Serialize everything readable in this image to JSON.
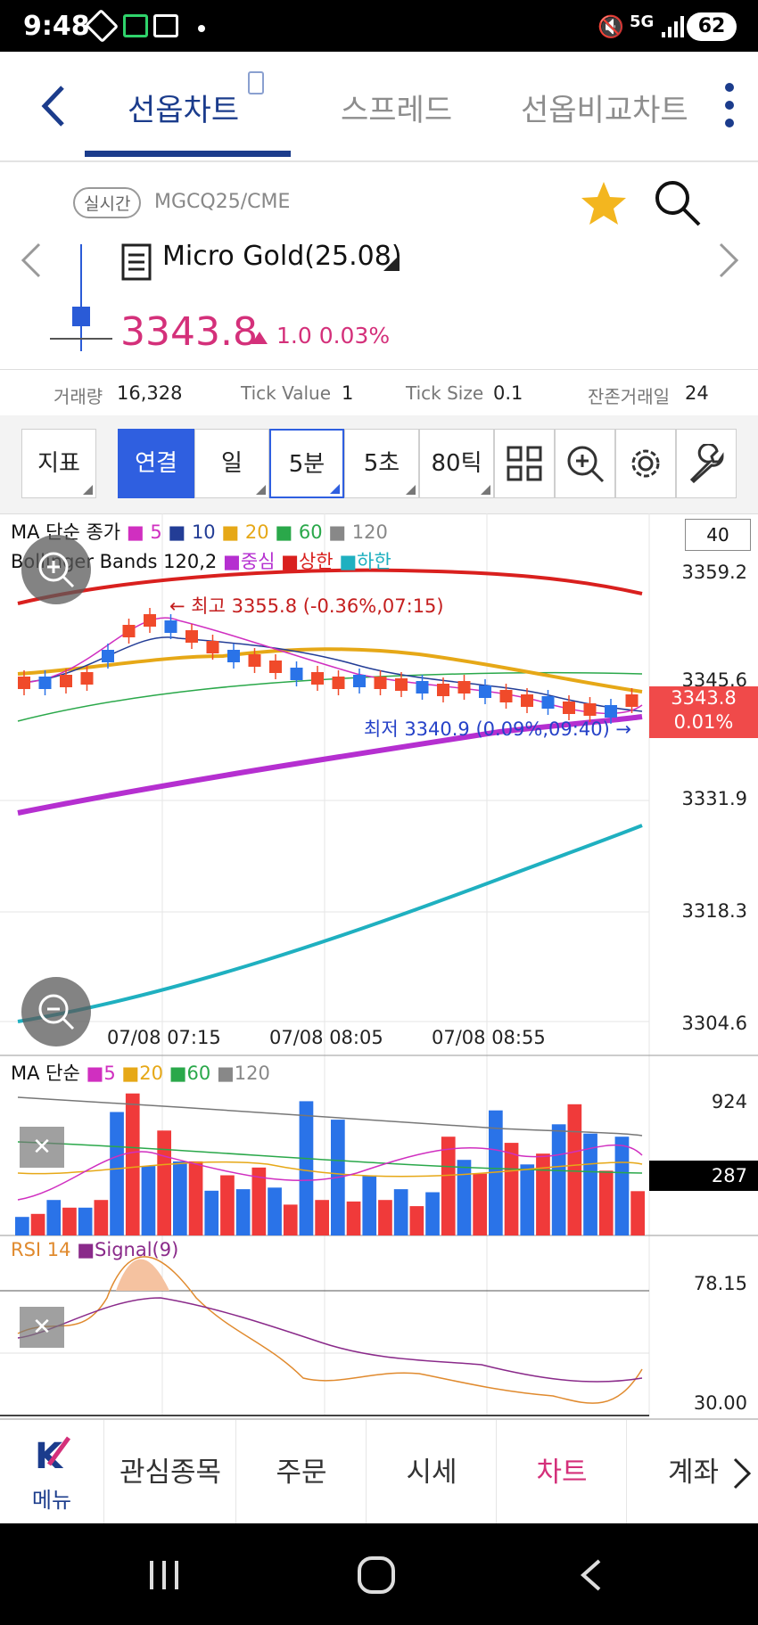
{
  "status_bar": {
    "time": "9:48",
    "battery": "62",
    "network": "5G"
  },
  "header": {
    "tabs": [
      {
        "label": "선옵차트"
      },
      {
        "label": "스프레드"
      },
      {
        "label": "선옵비교차트"
      }
    ]
  },
  "instrument": {
    "realtime_badge": "실시간",
    "code": "MGCQ25/CME",
    "name": "Micro Gold(25.08)",
    "price": "3343.8",
    "change": "1.0 0.03%",
    "colors": {
      "up": "#d4307a",
      "accent": "#1b3c8c",
      "star": "#f3b61f"
    }
  },
  "info": {
    "volume_label": "거래량",
    "volume_value": "16,328",
    "tick_value_label": "Tick Value",
    "tick_value_value": "1",
    "tick_size_label": "Tick Size",
    "tick_size_value": "0.1",
    "remaining_label": "잔존거래일",
    "remaining_value": "24"
  },
  "toolbar": {
    "indicator": "지표",
    "linked": "연결",
    "day": "일",
    "min5": "5분",
    "sec5": "5초",
    "tick80": "80틱",
    "icons": [
      "grid-icon",
      "zoom-in-icon",
      "gear-icon",
      "wrench-icon"
    ]
  },
  "price_chart": {
    "ma_legend": {
      "title": "MA 단순 종가",
      "p1": "5",
      "p2": "10",
      "p3": "20",
      "p4": "60",
      "p5": "120"
    },
    "bb_legend": {
      "title": "Bollinger Bands 120,2",
      "mid": "중심",
      "upper": "상한",
      "lower": "하한"
    },
    "period_box": "40",
    "high_note": "← 최고 3355.8 (-0.36%,07:15)",
    "low_note": "최저 3340.9 (0.09%,09:40) →",
    "current_price": "3343.8",
    "current_pct": "0.01%",
    "y_labels": [
      "3359.2",
      "3345.6",
      "3331.9",
      "3318.3",
      "3304.6"
    ],
    "x_labels": [
      "07/08 07:15",
      "07/08 08:05",
      "07/08 08:55"
    ]
  },
  "volume_chart": {
    "legend": {
      "title": "MA 단순",
      "p1": "5",
      "p2": "20",
      "p3": "60",
      "p4": "120"
    },
    "y_labels": [
      "924"
    ],
    "current": "287"
  },
  "rsi_chart": {
    "legend": {
      "rsi": "RSI 14",
      "signal": "Signal(9)"
    },
    "y_labels": [
      "78.15",
      "30.00"
    ]
  },
  "chart_data": [
    {
      "type": "line",
      "title": "Micro Gold(25.08) 5분",
      "ylim": [
        3304.6,
        3359.2
      ],
      "x": [
        "07/08 07:15",
        "07/08 08:05",
        "07/08 08:55"
      ],
      "series": [
        {
          "name": "상한",
          "values": [
            3355.5,
            3357.5,
            3357.3,
            3355.6
          ]
        },
        {
          "name": "하한",
          "values": [
            3305.0,
            3310.5,
            3318.0,
            3327.5
          ]
        },
        {
          "name": "중심",
          "values": [
            3327.5,
            3334.0,
            3337.6,
            3341.2
          ]
        }
      ],
      "high": 3355.8,
      "low": 3340.9,
      "last": 3343.8
    },
    {
      "type": "bar",
      "title": "Volume",
      "ylim": [
        0,
        924
      ],
      "values": [
        120,
        140,
        230,
        180,
        180,
        230,
        800,
        920,
        450,
        680,
        480,
        480,
        290,
        390,
        300,
        440,
        310,
        200,
        870,
        230,
        750,
        220,
        390,
        230,
        300,
        190,
        280,
        640,
        490,
        400,
        810,
        600,
        460,
        530,
        720,
        850,
        660,
        420,
        640,
        287
      ]
    },
    {
      "type": "line",
      "title": "RSI 14",
      "ylim": [
        30.0,
        78.15
      ],
      "series": [
        {
          "name": "RSI 14",
          "values": [
            55,
            52,
            56,
            62,
            78,
            72,
            60,
            50,
            48,
            45,
            40,
            38,
            35,
            36,
            37,
            38,
            40,
            38,
            35,
            37,
            38,
            34,
            31,
            30,
            38,
            42
          ]
        },
        {
          "name": "Signal(9)",
          "values": [
            50,
            50,
            53,
            60,
            66,
            68,
            65,
            60,
            56,
            52,
            48,
            45,
            43,
            42,
            41,
            40,
            40,
            39,
            38,
            37,
            37,
            36,
            35,
            34,
            35,
            36
          ]
        }
      ]
    }
  ],
  "bottom_nav": {
    "menu": "메뉴",
    "watchlist": "관심종목",
    "order": "주문",
    "quote": "시세",
    "chart": "차트",
    "account": "계좌"
  }
}
